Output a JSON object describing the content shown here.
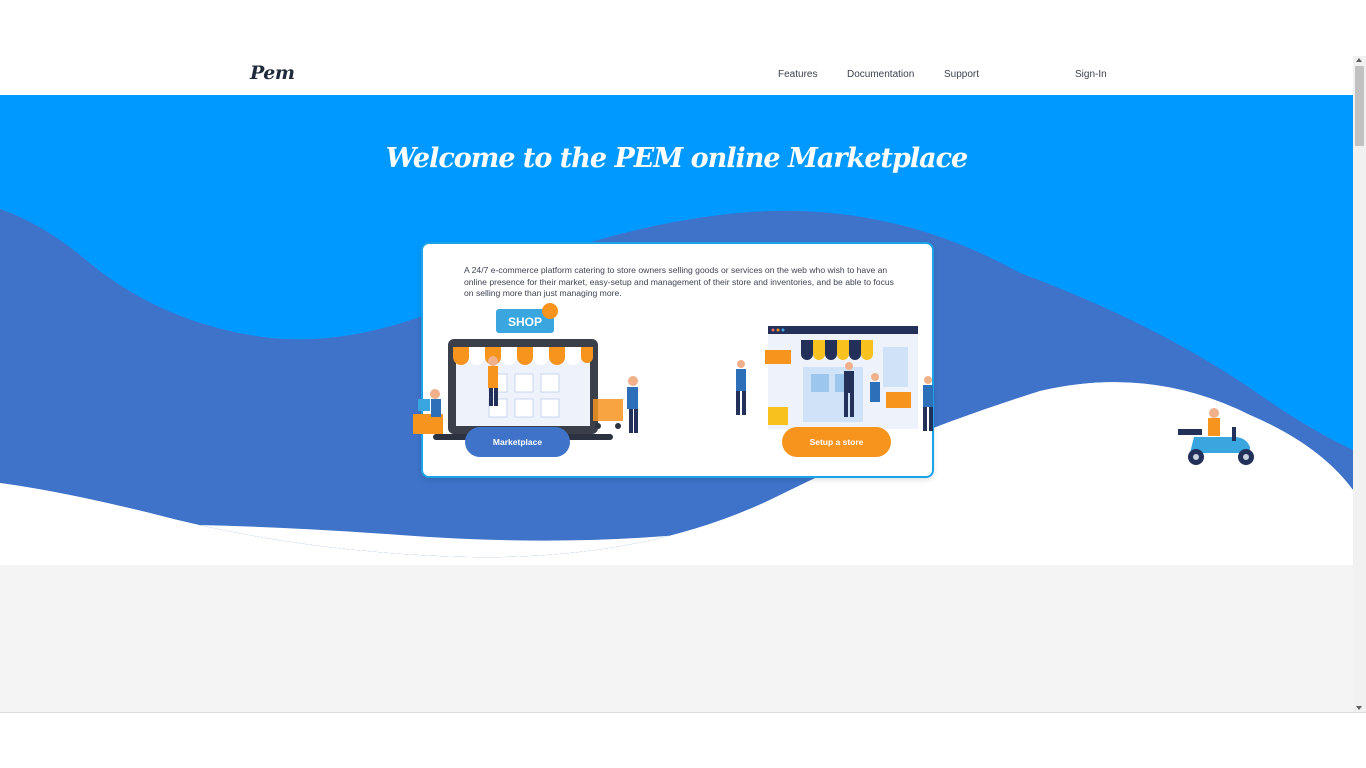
{
  "brand": {
    "logo_text": "Pem"
  },
  "nav": {
    "features": "Features",
    "documentation": "Documentation",
    "support": "Support",
    "signin": "Sign-In"
  },
  "hero": {
    "title": "Welcome to the PEM online Marketplace",
    "description": "A 24/7 e-commerce platform catering to store owners selling goods or services on the web who wish to have an online presence for their market, easy-setup and management of their store and inventories, and be able to focus on selling more than just managing more.",
    "shop_sign": "SHOP",
    "marketplace_button": "Marketplace",
    "setup_button": "Setup a store"
  },
  "colors": {
    "sky_blue": "#0099ff",
    "wave_blue": "#3e73c9",
    "accent_orange": "#f7941e",
    "page_gray": "#f4f4f5"
  }
}
